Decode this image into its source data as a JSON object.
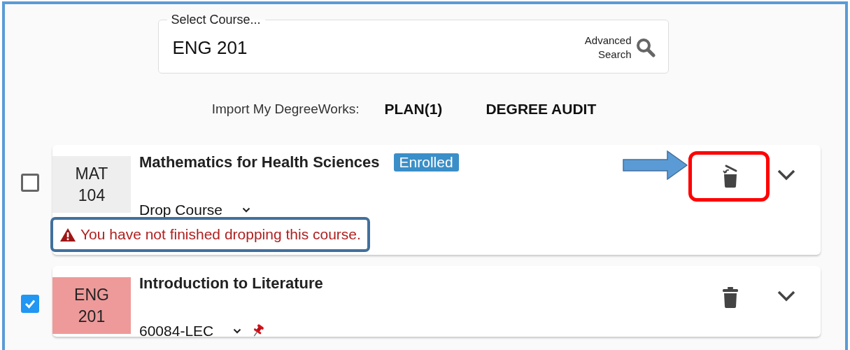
{
  "search": {
    "label": "Select Course...",
    "value": "ENG 201",
    "advanced_line_1": "Advanced",
    "advanced_line_2": "Search"
  },
  "import": {
    "label": "Import My DegreeWorks:",
    "links": [
      "PLAN(1)",
      "DEGREE AUDIT"
    ]
  },
  "courses": [
    {
      "checked": false,
      "subject": "MAT",
      "number": "104",
      "color": "#eeeeee",
      "title": "Mathematics for Health Sciences",
      "badge": "Enrolled",
      "section": "Drop Course",
      "pinned": false,
      "kind": "swap",
      "highlighted": true,
      "warning": "You have not finished dropping this course."
    },
    {
      "checked": true,
      "subject": "ENG",
      "number": "201",
      "color": "#ee9a9a",
      "title": "Introduction to Literature",
      "section": "60084-LEC",
      "pinned": true,
      "kind": "delete",
      "highlighted": false
    }
  ]
}
